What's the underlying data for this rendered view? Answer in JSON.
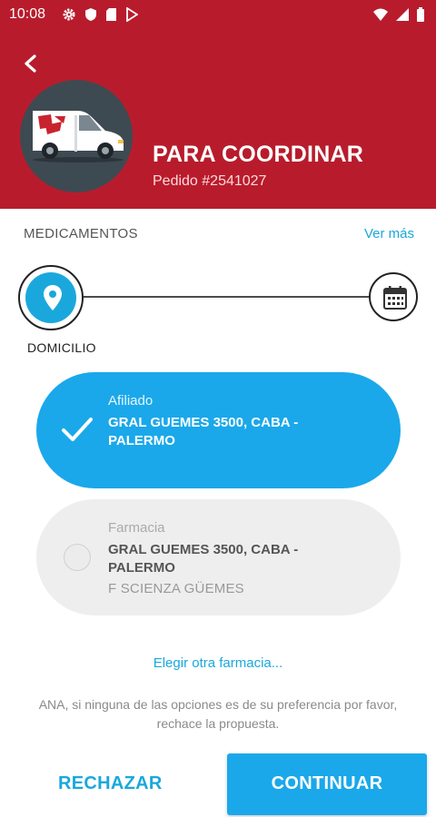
{
  "status_bar": {
    "time": "10:08",
    "left_icons": [
      "gear-icon",
      "shield-icon",
      "sd-card-icon",
      "play-store-icon"
    ],
    "right_icons": [
      "wifi-icon",
      "cell-signal-icon",
      "battery-icon"
    ]
  },
  "header": {
    "title": "PARA COORDINAR",
    "order": "Pedido #2541027",
    "avatar_icon": "delivery-van-icon",
    "background_color": "#b81c2c"
  },
  "section": {
    "label": "MEDICAMENTOS",
    "link": "Ver más"
  },
  "stepper": {
    "active_step_label": "DOMICILIO",
    "steps": [
      "location-pin-icon",
      "calendar-icon"
    ]
  },
  "options": [
    {
      "type": "Afiliado",
      "address": "GRAL GUEMES 3500, CABA - PALERMO",
      "selected": true
    },
    {
      "type": "Farmacia",
      "address": "GRAL GUEMES 3500, CABA - PALERMO",
      "pharmacy": "F SCIENZA GÜEMES",
      "selected": false
    }
  ],
  "other_pharmacy_link": "Elegir otra farmacia...",
  "note": "ANA, si ninguna de las opciones es de su preferencia por favor, rechace la propuesta.",
  "actions": {
    "reject": "RECHAZAR",
    "continue": "CONTINUAR"
  },
  "colors": {
    "accent": "#1aa8ea",
    "brand_red": "#b81c2c"
  }
}
